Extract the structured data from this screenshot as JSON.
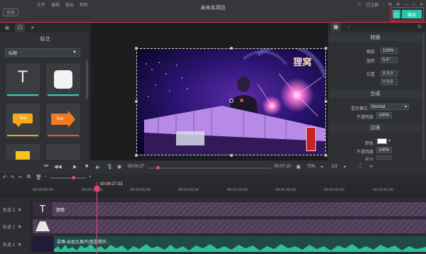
{
  "titlebar": {
    "menus": [
      "文件",
      "编辑",
      "输出",
      "帮助"
    ],
    "feedback_label": "实验",
    "project_title": "未命名项目",
    "login_label": "已注册",
    "save_label": "已",
    "export_label": "输出"
  },
  "left_panel": {
    "title": "标注",
    "category": "标题",
    "tiles": [
      {
        "kind": "text",
        "glyph": "T",
        "underline": "#2ad2bd"
      },
      {
        "kind": "shape",
        "underline": "#2ad2bd"
      },
      {
        "kind": "callout",
        "text": "Text",
        "underline": "#e0a23a"
      },
      {
        "kind": "arrow",
        "text": "Text",
        "underline": "#e85a2a"
      }
    ]
  },
  "video": {
    "watermark": "狸窝",
    "seal_text": "吃瓜\n人"
  },
  "right_panel": {
    "section_transform": "转换",
    "scale_label": "缩放",
    "scale_value": "100%",
    "rotate_label": "旋转",
    "rotate_value": "0.0°",
    "position_label": "位置",
    "x_value": "X  0.0",
    "y_value": "Y  0.0",
    "section_composite": "合成",
    "blend_label": "混合模式",
    "blend_value": "Normal",
    "opacity_label": "不透明度",
    "opacity_value": "100%",
    "section_border": "边境",
    "color_label": "颜色",
    "border_opacity_label": "不透明度",
    "border_opacity_value": "100%",
    "size_label": "尺寸"
  },
  "transport": {
    "current_time": "00:00:27",
    "total_time": "00:07:15",
    "zoom": "75%",
    "ratio": "1/2"
  },
  "timeline": {
    "playhead_time": "00:00:27.03",
    "ticks": [
      "00:00:00.00",
      "00:00:20.00",
      "00:00:40.00",
      "00:01:00.00",
      "00:01:20.00",
      "00:01:40.00",
      "00:02:00.00",
      "00:02:20.00"
    ],
    "tracks": [
      {
        "name": "轨道 3",
        "clip": "狸窝"
      },
      {
        "name": "轨道 2",
        "clip": ""
      },
      {
        "name": "轨道 1",
        "clip": "梁博-出现又离开(我是唱作..."
      }
    ]
  },
  "colors": {
    "accent": "#25c7ae",
    "playhead": "#e04a6d",
    "highlight": "#e3262e"
  }
}
